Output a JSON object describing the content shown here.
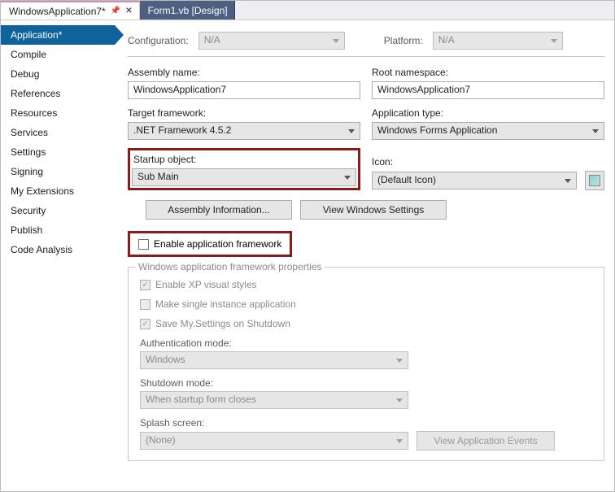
{
  "tabs": {
    "active": "WindowsApplication7*",
    "inactive": "Form1.vb [Design]"
  },
  "sidebar": {
    "items": [
      "Application*",
      "Compile",
      "Debug",
      "References",
      "Resources",
      "Services",
      "Settings",
      "Signing",
      "My Extensions",
      "Security",
      "Publish",
      "Code Analysis"
    ]
  },
  "top": {
    "config_label": "Configuration:",
    "config_value": "N/A",
    "platform_label": "Platform:",
    "platform_value": "N/A"
  },
  "assembly": {
    "name_label": "Assembly name:",
    "name_value": "WindowsApplication7",
    "rootns_label": "Root namespace:",
    "rootns_value": "WindowsApplication7",
    "target_fw_label": "Target framework:",
    "target_fw_value": ".NET Framework 4.5.2",
    "app_type_label": "Application type:",
    "app_type_value": "Windows Forms Application",
    "startup_label": "Startup object:",
    "startup_value": "Sub Main",
    "icon_label": "Icon:",
    "icon_value": "(Default Icon)"
  },
  "buttons": {
    "assembly_info": "Assembly Information...",
    "view_windows_settings": "View Windows Settings",
    "view_app_events": "View Application Events"
  },
  "checkbox": {
    "enable_framework": "Enable application framework"
  },
  "framework": {
    "legend": "Windows application framework properties",
    "xp_styles": "Enable XP visual styles",
    "single_instance": "Make single instance application",
    "save_settings": "Save My.Settings on Shutdown",
    "auth_label": "Authentication mode:",
    "auth_value": "Windows",
    "shutdown_label": "Shutdown mode:",
    "shutdown_value": "When startup form closes",
    "splash_label": "Splash screen:",
    "splash_value": "(None)"
  }
}
